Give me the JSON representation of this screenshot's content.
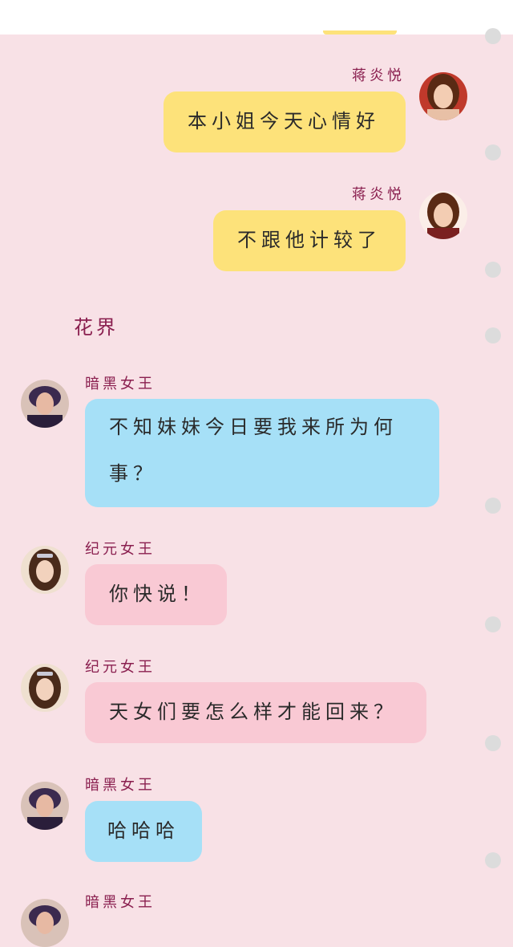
{
  "section_title": "花界",
  "messages": [
    {
      "sender": "蒋炎悦",
      "text": "本小姐今天心情好"
    },
    {
      "sender": "蒋炎悦",
      "text": "不跟他计较了"
    },
    {
      "sender": "暗黑女王",
      "text_line1": "不知妹妹今日要我来所为何",
      "text_line2": "事？"
    },
    {
      "sender": "纪元女王",
      "text": "你快说！"
    },
    {
      "sender": "纪元女王",
      "text": "天女们要怎么样才能回来？"
    },
    {
      "sender": "暗黑女王",
      "text": "哈哈哈"
    },
    {
      "sender": "暗黑女王"
    }
  ],
  "colors": {
    "background": "#f8e1e6",
    "yellow_bubble": "#fde27a",
    "blue_bubble": "#a6e0f7",
    "pink_bubble": "#f9c9d4",
    "name_color": "#8a1f4f"
  }
}
